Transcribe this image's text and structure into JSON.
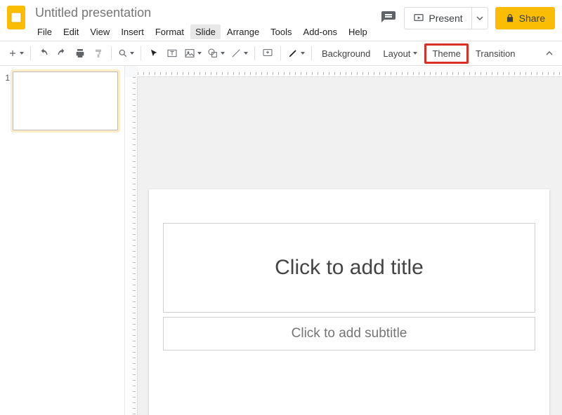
{
  "doc": {
    "title": "Untitled presentation"
  },
  "menu": [
    "File",
    "Edit",
    "View",
    "Insert",
    "Format",
    "Slide",
    "Arrange",
    "Tools",
    "Add-ons",
    "Help"
  ],
  "menu_active_index": 5,
  "header": {
    "present": "Present",
    "share": "Share"
  },
  "toolbar_labels": {
    "background": "Background",
    "layout": "Layout",
    "theme": "Theme",
    "transition": "Transition"
  },
  "sidebar": {
    "slides": [
      {
        "num": "1"
      }
    ]
  },
  "slide": {
    "title_placeholder": "Click to add title",
    "subtitle_placeholder": "Click to add subtitle"
  },
  "highlighted_tool": "theme"
}
